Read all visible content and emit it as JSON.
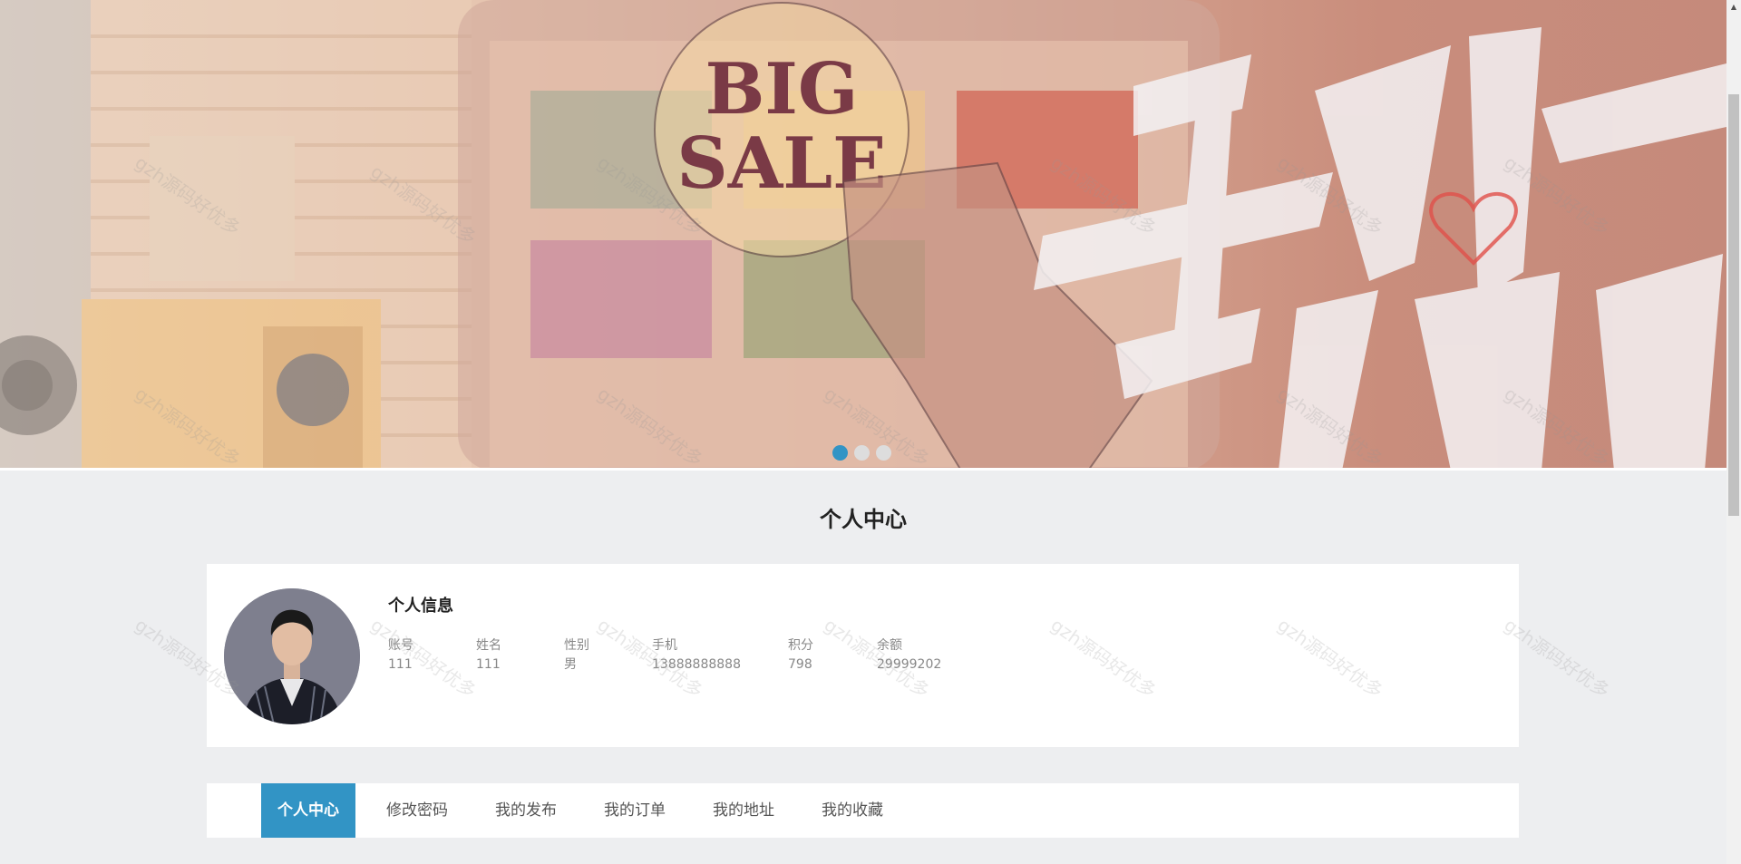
{
  "banner": {
    "headline_line1": "BIG",
    "headline_line2": "SALE",
    "slides": 3,
    "active_slide": 1,
    "accent_color": "#3294c5"
  },
  "page": {
    "title": "个人中心"
  },
  "profile": {
    "section_title": "个人信息",
    "fields": [
      {
        "label": "账号",
        "value": "111"
      },
      {
        "label": "姓名",
        "value": "111"
      },
      {
        "label": "性别",
        "value": "男"
      },
      {
        "label": "手机",
        "value": "13888888888"
      },
      {
        "label": "积分",
        "value": "798"
      },
      {
        "label": "余额",
        "value": "29999202"
      }
    ]
  },
  "tabs": [
    {
      "label": "个人中心",
      "active": true
    },
    {
      "label": "修改密码",
      "active": false
    },
    {
      "label": "我的发布",
      "active": false
    },
    {
      "label": "我的订单",
      "active": false
    },
    {
      "label": "我的地址",
      "active": false
    },
    {
      "label": "我的收藏",
      "active": false
    }
  ],
  "watermark": {
    "text": "gzh源码好优多"
  }
}
